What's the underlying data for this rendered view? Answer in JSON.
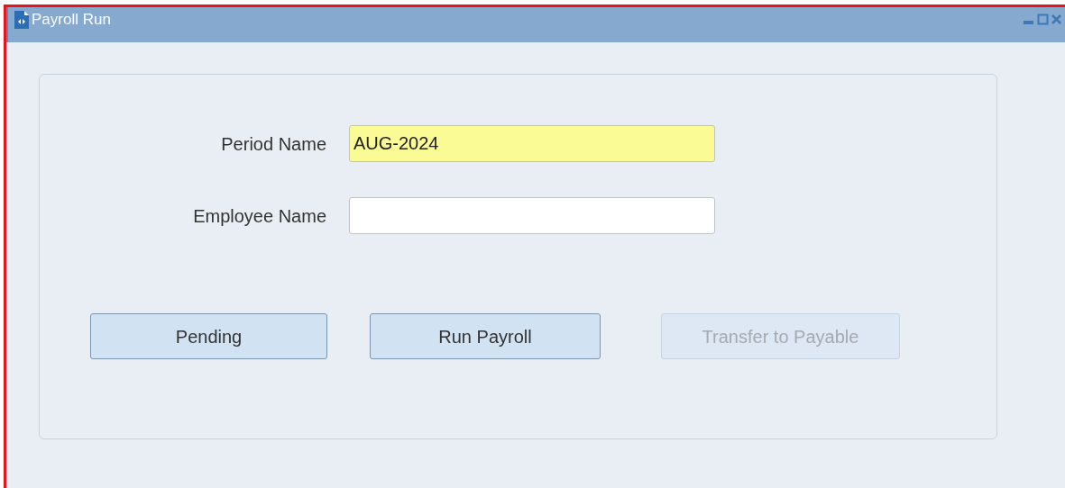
{
  "window": {
    "title": "Payroll Run"
  },
  "fields": [
    {
      "label": "Period Name",
      "value": "AUG-2024",
      "required": true
    },
    {
      "label": "Employee Name",
      "required": false
    }
  ],
  "buttons": [
    {
      "label": "Pending",
      "disabled": false
    },
    {
      "label": "Run Payroll",
      "disabled": false
    },
    {
      "label": "Transfer to Payable",
      "disabled": true
    }
  ]
}
